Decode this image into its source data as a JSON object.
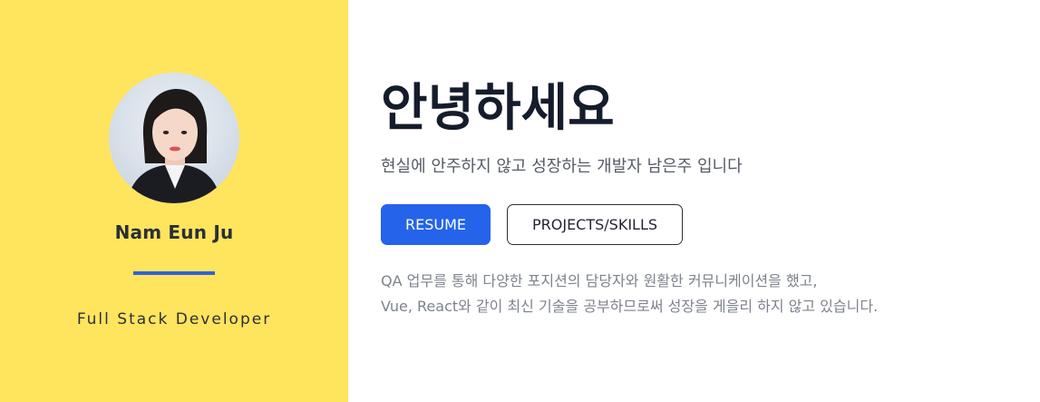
{
  "profile": {
    "name": "Nam Eun Ju",
    "role": "Full Stack Developer"
  },
  "hero": {
    "greeting": "안녕하세요",
    "subtitle": "현실에 안주하지 않고 성장하는 개발자 남은주 입니다"
  },
  "buttons": {
    "resume": "RESUME",
    "projects": "PROJECTS/SKILLS"
  },
  "intro": {
    "line1": "QA 업무를 통해 다양한 포지션의 담당자와 원활한 커뮤니케이션을 했고,",
    "line2": "Vue, React와 같이 최신 기술을 공부하므로써 성장을 게을리 하지 않고 있습니다."
  },
  "colors": {
    "sidebar_bg": "#ffe45e",
    "accent": "#2563eb",
    "divider": "#2e63db"
  }
}
